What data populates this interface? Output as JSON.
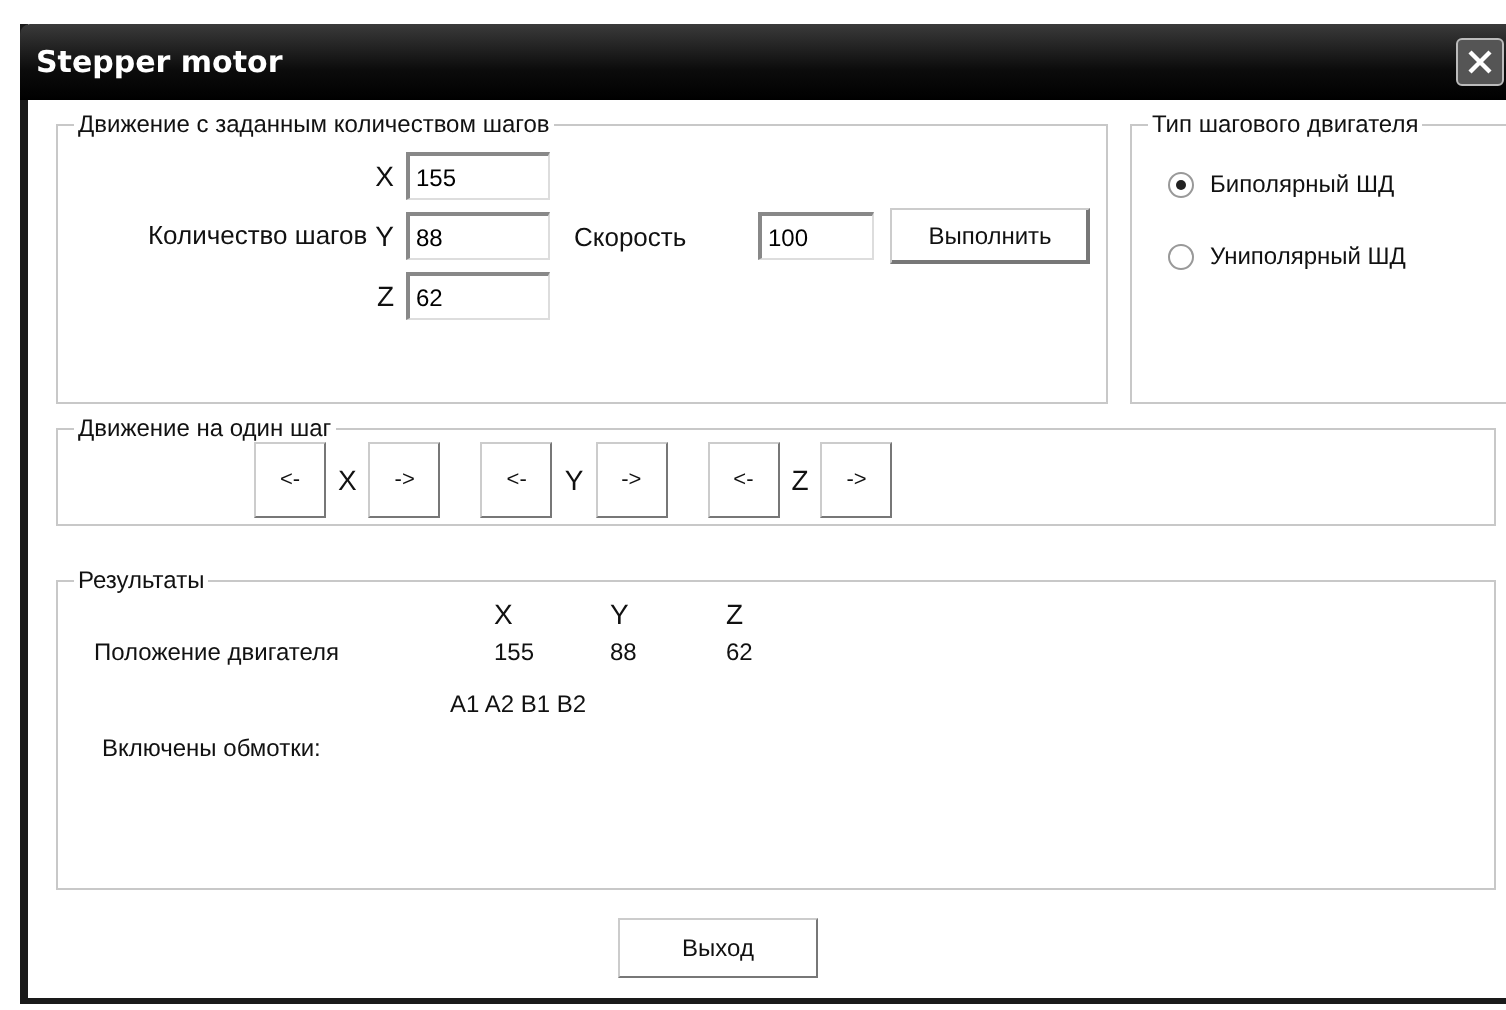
{
  "window": {
    "title": "Stepper motor"
  },
  "steps_group": {
    "title": "Движение с заданным количеством шагов",
    "count_label": "Количество шагов",
    "axis_fields": [
      {
        "axis": "X",
        "value": "155"
      },
      {
        "axis": "Y",
        "value": "88"
      },
      {
        "axis": "Z",
        "value": "62"
      }
    ],
    "speed_label": "Скорость",
    "speed_value": "100",
    "run_button": "Выполнить"
  },
  "motor_type": {
    "title": "Тип шагового двигателя",
    "options": [
      {
        "label": "Биполярный ШД",
        "selected": true
      },
      {
        "label": "Униполярный ШД",
        "selected": false
      }
    ]
  },
  "single_step": {
    "title": "Движение на один шаг",
    "axes": [
      {
        "back": "<-",
        "axis": "X",
        "forward": "->"
      },
      {
        "back": "<-",
        "axis": "Y",
        "forward": "->"
      },
      {
        "back": "<-",
        "axis": "Z",
        "forward": "->"
      }
    ]
  },
  "results": {
    "title": "Результаты",
    "columns": [
      "X",
      "Y",
      "Z"
    ],
    "position_label": "Положение двигателя",
    "position_values": [
      "155",
      "88",
      "62"
    ],
    "windings_value": "A1 A2 B1 B2",
    "windings_label": "Включены обмотки:"
  },
  "exit_button": "Выход"
}
